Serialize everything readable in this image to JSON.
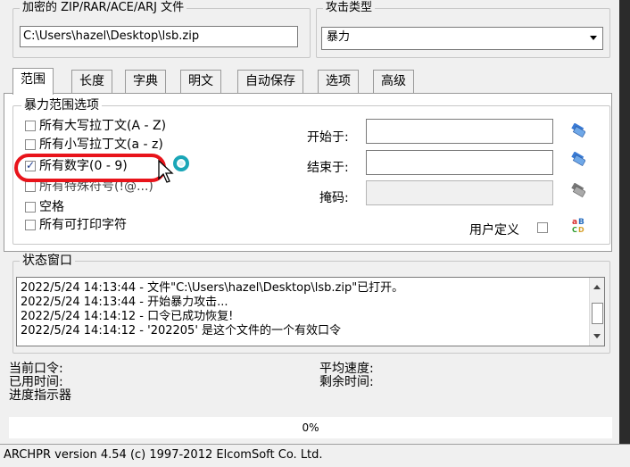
{
  "encrypted_file": {
    "legend": "加密的 ZIP/RAR/ACE/ARJ 文件",
    "path": "C:\\Users\\hazel\\Desktop\\lsb.zip"
  },
  "attack_type": {
    "legend": "攻击类型",
    "selected": "暴力"
  },
  "tabs": [
    {
      "label": "范围",
      "active": true
    },
    {
      "label": "长度",
      "active": false
    },
    {
      "label": "字典",
      "active": false
    },
    {
      "label": "明文",
      "active": false
    },
    {
      "label": "自动保存",
      "active": false
    },
    {
      "label": "选项",
      "active": false
    },
    {
      "label": "高级",
      "active": false
    }
  ],
  "range_options": {
    "legend": "暴力范围选项",
    "checkboxes": [
      {
        "label": "所有大写拉丁文(A - Z)",
        "checked": false
      },
      {
        "label": "所有小写拉丁文(a - z)",
        "checked": false
      },
      {
        "label": "所有数字(0 - 9)",
        "checked": true
      },
      {
        "label": "所有特殊符号(!@...)",
        "checked": false
      },
      {
        "label": "空格",
        "checked": false
      },
      {
        "label": "所有可打印字符",
        "checked": false
      }
    ],
    "start_label": "开始于:",
    "start_value": "",
    "end_label": "结束于:",
    "end_value": "",
    "mask_label": "掩码:",
    "mask_value": "",
    "user_defined_label": "用户定义"
  },
  "status_window": {
    "legend": "状态窗口",
    "lines": [
      "2022/5/24 14:13:44 - 文件\"C:\\Users\\hazel\\Desktop\\lsb.zip\"已打开。",
      "2022/5/24 14:13:44 - 开始暴力攻击...",
      "2022/5/24 14:14:12 - 口令已成功恢复!",
      "2022/5/24 14:14:12 - '202205' 是这个文件的一个有效口令"
    ]
  },
  "stats": {
    "current_password_label": "当前口令:",
    "avg_speed_label": "平均速度:",
    "elapsed_label": "已用时间:",
    "remaining_label": "剩余时间:",
    "progress_label": "进度指示器",
    "progress_text": "0%",
    "progress_value": 0
  },
  "status_bar": "ARCHPR version 4.54 (c) 1997-2012 ElcomSoft Co. Ltd.",
  "colors": {
    "highlight_red": "#e8141b",
    "teal_circle": "#1aa6b7",
    "icon_blue": "#2a6fc0"
  }
}
